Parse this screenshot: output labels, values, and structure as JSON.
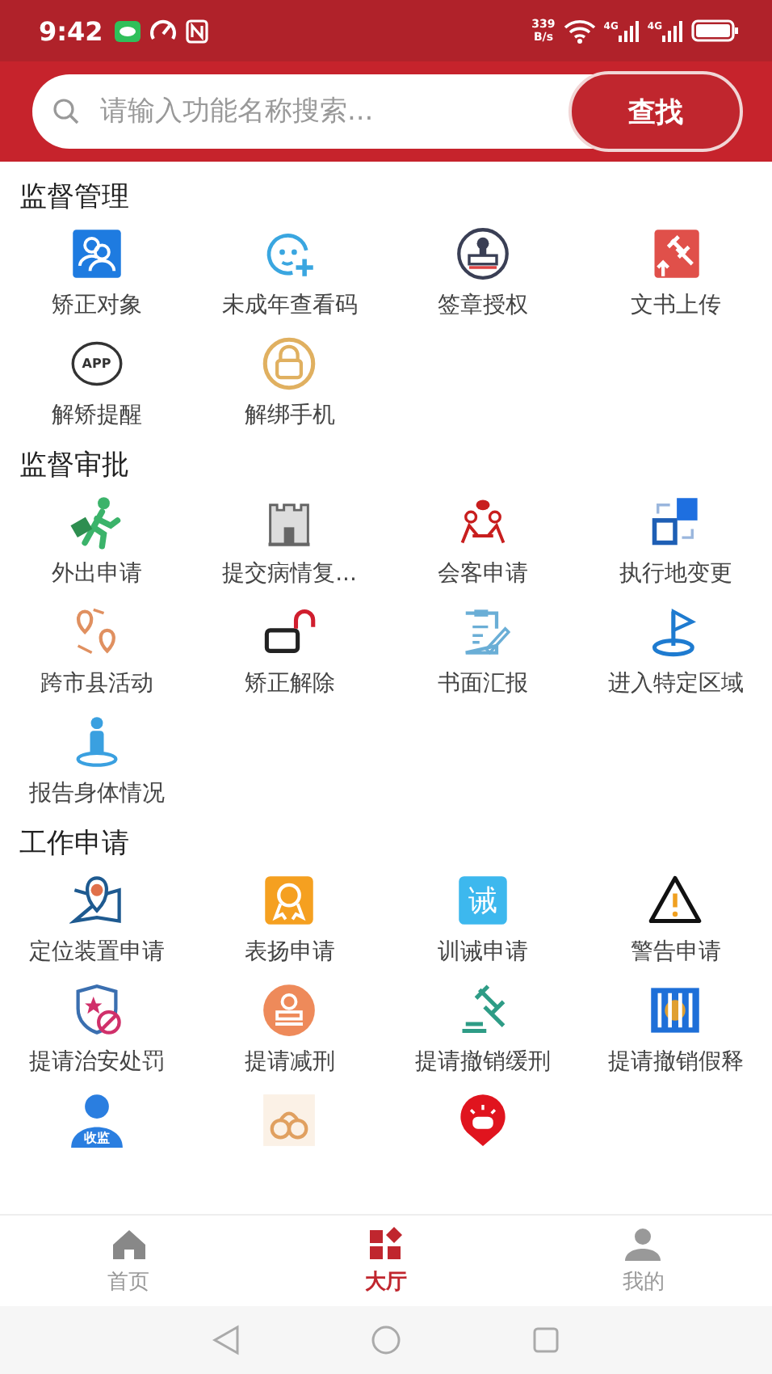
{
  "status_bar": {
    "time": "9:42",
    "net_speed": "339",
    "net_unit": "B/s",
    "sim_1": "4G",
    "sim_2": "4G"
  },
  "search": {
    "placeholder": "请输入功能名称搜索...",
    "button": "查找"
  },
  "sections": [
    {
      "title": "监督管理",
      "items": [
        {
          "label": "矫正对象"
        },
        {
          "label": "未成年查看码"
        },
        {
          "label": "签章授权"
        },
        {
          "label": "文书上传"
        },
        {
          "label": "解矫提醒",
          "badge": "APP"
        },
        {
          "label": "解绑手机"
        }
      ]
    },
    {
      "title": "监督审批",
      "items": [
        {
          "label": "外出申请"
        },
        {
          "label": "提交病情复..."
        },
        {
          "label": "会客申请"
        },
        {
          "label": "执行地变更"
        },
        {
          "label": "跨市县活动"
        },
        {
          "label": "矫正解除"
        },
        {
          "label": "书面汇报"
        },
        {
          "label": "进入特定区域"
        },
        {
          "label": "报告身体情况"
        }
      ]
    },
    {
      "title": "工作申请",
      "items": [
        {
          "label": "定位装置申请"
        },
        {
          "label": "表扬申请"
        },
        {
          "label": "训诫申请",
          "badge": "诫"
        },
        {
          "label": "警告申请"
        },
        {
          "label": "提请治安处罚"
        },
        {
          "label": "提请减刑"
        },
        {
          "label": "提请撤销缓刑"
        },
        {
          "label": "提请撤销假释"
        },
        {
          "kind": "icon_only",
          "badge": "收监"
        },
        {
          "kind": "icon_only"
        },
        {
          "kind": "icon_only"
        }
      ]
    }
  ],
  "tab_bar": [
    {
      "label": "首页",
      "selected": false
    },
    {
      "label": "大厅",
      "selected": true
    },
    {
      "label": "我的",
      "selected": false
    }
  ]
}
